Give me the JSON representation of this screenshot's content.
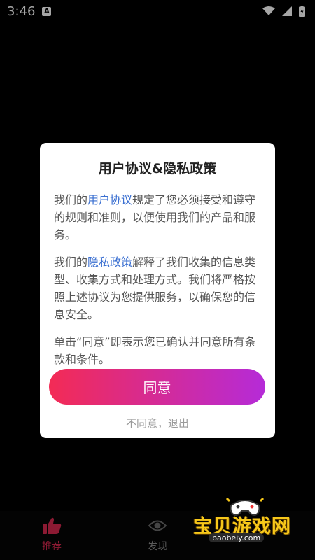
{
  "status_bar": {
    "time": "3:46",
    "notification_icon": "A"
  },
  "bottom_nav": {
    "items": [
      {
        "label": "推荐",
        "icon": "thumbs-up-icon",
        "color": "#d8284f"
      },
      {
        "label": "发现",
        "icon": "eye-icon",
        "color": "#8a8a8a"
      }
    ]
  },
  "dialog": {
    "title": "用户协议&隐私政策",
    "para1": {
      "prefix": "我们的",
      "link": "用户协议",
      "suffix": "规定了您必须接受和遵守的规则和准则，以便使用我们的产品和服务。"
    },
    "para2": {
      "prefix": "我们的",
      "link": "隐私政策",
      "suffix": "解释了我们收集的信息类型、收集方式和处理方式。我们将严格按照上述协议为您提供服务，以确保您的信息安全。"
    },
    "para3": "单击“同意”即表示您已确认并同意所有条款和条件。",
    "agree_label": "同意",
    "disagree_label": "不同意，退出"
  },
  "watermark": {
    "text": "宝贝游戏网",
    "url": "baobeiy.com"
  },
  "colors": {
    "accent_start": "#f32b55",
    "accent_end": "#b52bd8",
    "link": "#3a6fd1"
  }
}
